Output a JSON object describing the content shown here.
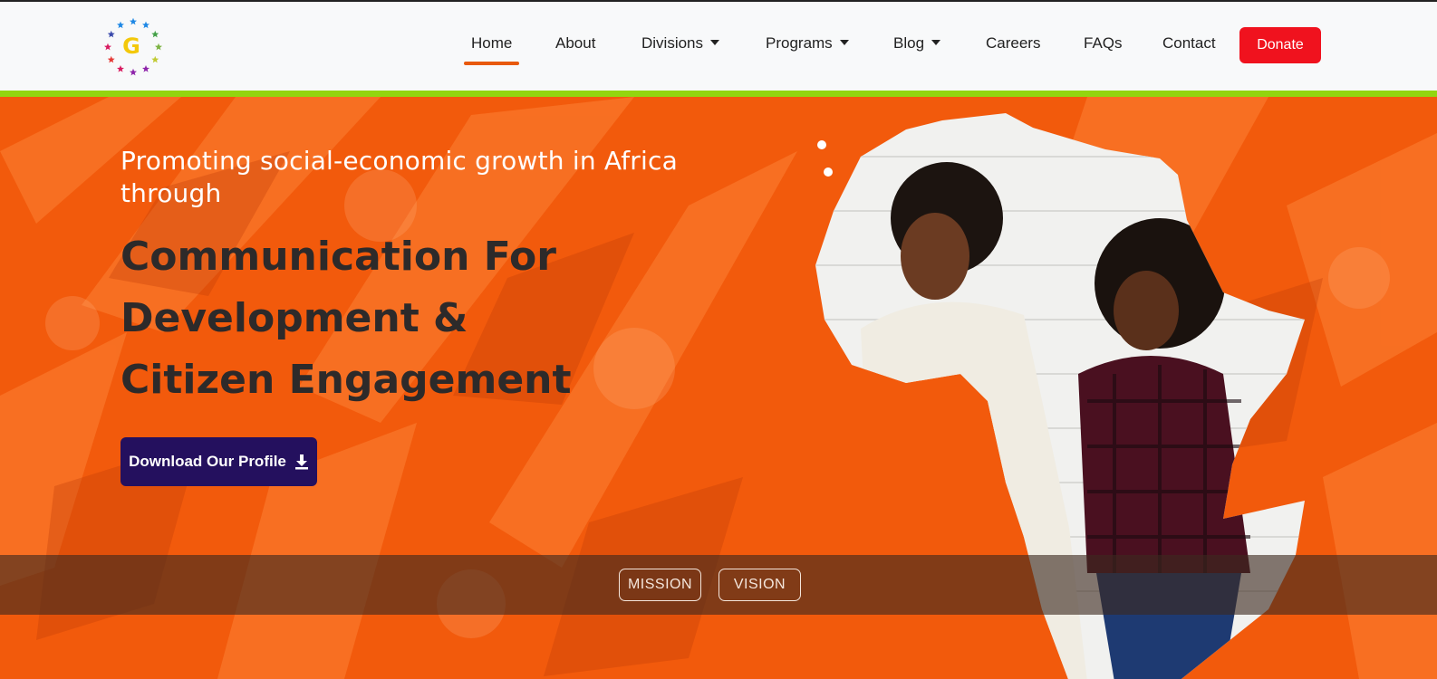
{
  "brand": {
    "logo_letter": "G",
    "logo_icon": "star-ring-logo-icon"
  },
  "nav": {
    "items": [
      {
        "label": "Home",
        "dropdown": false,
        "active": true
      },
      {
        "label": "About",
        "dropdown": false
      },
      {
        "label": "Divisions",
        "dropdown": true
      },
      {
        "label": "Programs",
        "dropdown": true
      },
      {
        "label": "Blog",
        "dropdown": true
      },
      {
        "label": "Careers",
        "dropdown": false
      },
      {
        "label": "FAQs",
        "dropdown": false
      },
      {
        "label": "Contact",
        "dropdown": false
      }
    ],
    "donate_label": "Donate"
  },
  "hero": {
    "tagline": "Promoting social-economic growth in Africa through",
    "headline_lines": [
      "Communication For",
      "Development &",
      "Citizen Engagement"
    ],
    "cta_label": "Download Our Profile",
    "cta_icon": "download-icon"
  },
  "strip": {
    "mission_label": "MISSION",
    "vision_label": "VISION"
  },
  "colors": {
    "accent": "#e8590c",
    "donate": "#f0121e",
    "green_bar": "#93d50f",
    "hero_bg": "#f25a0c",
    "cta_bg": "#24105e",
    "headline": "#2d2a2a"
  }
}
